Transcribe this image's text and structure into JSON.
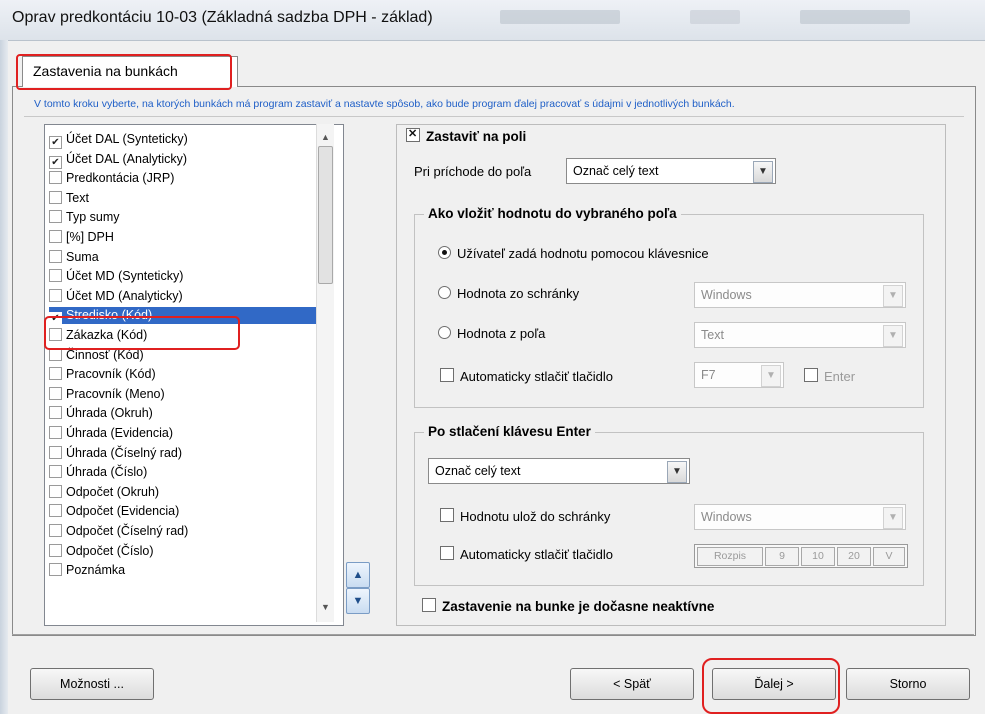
{
  "window": {
    "title": "Oprav predkontáciu 10-03 (Základná sadzba DPH - základ)"
  },
  "tabs": [
    {
      "label": "Zastavenia na bunkách",
      "active": true
    }
  ],
  "instruction": "V tomto kroku vyberte, na ktorých bunkách má program zastaviť a nastavte spôsob, ako bude program ďalej pracovať s údajmi v jednotlivých bunkách.",
  "cell_list": {
    "items": [
      {
        "label": "Účet DAL (Synteticky)",
        "checked": true,
        "selected": false
      },
      {
        "label": "Účet DAL (Analyticky)",
        "checked": true,
        "selected": false
      },
      {
        "label": "Predkontácia (JRP)",
        "checked": false,
        "selected": false
      },
      {
        "label": "Text",
        "checked": false,
        "selected": false
      },
      {
        "label": "Typ sumy",
        "checked": false,
        "selected": false
      },
      {
        "label": "[%] DPH",
        "checked": false,
        "selected": false
      },
      {
        "label": "Suma",
        "checked": false,
        "selected": false
      },
      {
        "label": "Účet MD (Synteticky)",
        "checked": false,
        "selected": false
      },
      {
        "label": "Účet MD (Analyticky)",
        "checked": false,
        "selected": false
      },
      {
        "label": "Stredisko (Kód)",
        "checked": true,
        "selected": true
      },
      {
        "label": "Zákazka (Kód)",
        "checked": false,
        "selected": false
      },
      {
        "label": "Činnosť (Kód)",
        "checked": false,
        "selected": false
      },
      {
        "label": "Pracovník (Kód)",
        "checked": false,
        "selected": false
      },
      {
        "label": "Pracovník (Meno)",
        "checked": false,
        "selected": false
      },
      {
        "label": "Úhrada (Okruh)",
        "checked": false,
        "selected": false
      },
      {
        "label": "Úhrada (Evidencia)",
        "checked": false,
        "selected": false
      },
      {
        "label": "Úhrada (Číselný rad)",
        "checked": false,
        "selected": false
      },
      {
        "label": "Úhrada (Číslo)",
        "checked": false,
        "selected": false
      },
      {
        "label": "Odpočet (Okruh)",
        "checked": false,
        "selected": false
      },
      {
        "label": "Odpočet (Evidencia)",
        "checked": false,
        "selected": false
      },
      {
        "label": "Odpočet (Číselný rad)",
        "checked": false,
        "selected": false
      },
      {
        "label": "Odpočet (Číslo)",
        "checked": false,
        "selected": false
      },
      {
        "label": "Poznámka",
        "checked": false,
        "selected": false
      }
    ]
  },
  "right_panel": {
    "stop_on_field": {
      "label": "Zastaviť na poli",
      "checked": true
    },
    "on_arrival_label": "Pri príchode do poľa",
    "on_arrival_value": "Označ celý text",
    "insert_group": {
      "title": "Ako vložiť hodnotu do vybraného poľa",
      "option_keyboard": {
        "label": "Užívateľ zadá hodnotu pomocou klávesnice",
        "selected": true
      },
      "option_clipboard": {
        "label": "Hodnota zo schránky",
        "selected": false,
        "combo_value": "Windows"
      },
      "option_field": {
        "label": "Hodnota z poľa",
        "selected": false,
        "combo_value": "Text"
      },
      "auto_press": {
        "label": "Automaticky stlačiť tlačidlo",
        "checked": false,
        "combo_value": "F7"
      },
      "enter_check": {
        "label": "Enter",
        "checked": false
      }
    },
    "after_enter_group": {
      "title": "Po stlačení klávesu Enter",
      "combo_value": "Označ celý text",
      "save_clipboard": {
        "label": "Hodnotu ulož do schránky",
        "checked": false,
        "combo_value": "Windows"
      },
      "auto_press": {
        "label": "Automaticky stlačiť tlačidlo",
        "checked": false
      },
      "key_buttons": [
        "Rozpis",
        "9",
        "10",
        "20",
        "V"
      ]
    },
    "inactive_stop": {
      "label": "Zastavenie na bunke je dočasne neaktívne",
      "checked": false
    }
  },
  "footer": {
    "options_label": "Možnosti ...",
    "back_label": "< Späť",
    "next_label": "Ďalej >",
    "cancel_label": "Storno"
  },
  "colors": {
    "selection": "#3169c6",
    "annotation_red": "#e02020",
    "instruction_blue": "#1f5fc7"
  }
}
